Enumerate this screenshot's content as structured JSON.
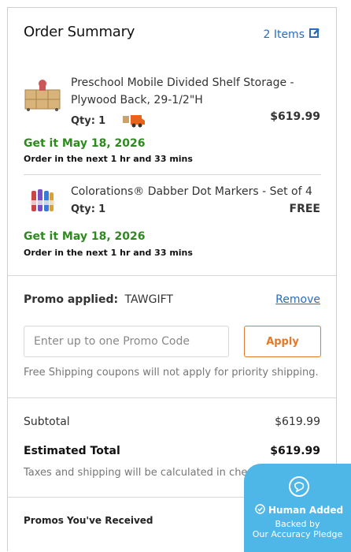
{
  "header": {
    "title": "Order Summary",
    "items_count": "2 Items"
  },
  "items": [
    {
      "name_line1": "Preschool Mobile Divided Shelf Storage -",
      "name_line2": "Plywood Back, 29-1/2\"H",
      "qty_label": "Qty:",
      "qty_value": "1",
      "price": "$619.99",
      "ship_date": "Get it May 18, 2026",
      "ship_note": "Order in the next 1 hr and 33 mins"
    },
    {
      "name_line1": "Colorations® Dabber Dot Markers - Set of 4",
      "qty_label": "Qty:",
      "qty_value": "1",
      "price": "FREE",
      "ship_date": "Get it May 18, 2026",
      "ship_note": "Order in the next 1 hr and 33 mins"
    }
  ],
  "promo": {
    "applied_label": "Promo applied:",
    "applied_code": "TAWGIFT",
    "remove_label": "Remove",
    "input_placeholder": "Enter up to one Promo Code",
    "apply_label": "Apply",
    "note": "Free Shipping coupons will not apply for priority shipping."
  },
  "summary": {
    "subtotal_label": "Subtotal",
    "subtotal_value": "$619.99",
    "total_label": "Estimated Total",
    "total_value": "$619.99",
    "taxes_note": "Taxes and shipping will be calculated in checkout."
  },
  "promos_received": {
    "label": "Promos You've Received"
  },
  "badge": {
    "title": "Human Added",
    "line1": "Backed by",
    "line2": "Our Accuracy Pledge"
  },
  "colors": {
    "link": "#2a6cc0",
    "ship_green": "#2e8a1f",
    "apply_orange": "#e07a2c",
    "badge_blue": "#4fb7e8"
  }
}
